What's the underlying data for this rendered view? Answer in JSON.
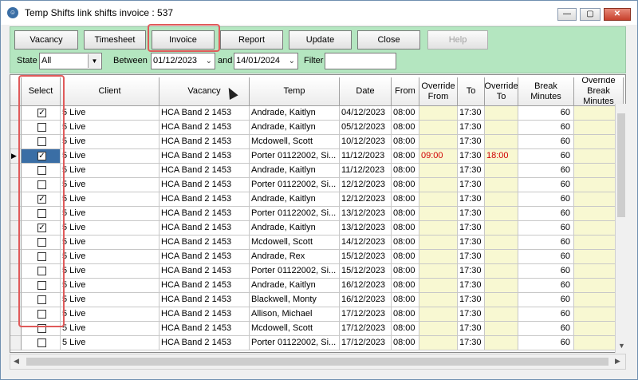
{
  "window": {
    "title": "Temp Shifts link shifts invoice : 537"
  },
  "toolbar": {
    "buttons": [
      {
        "label": "Vacancy"
      },
      {
        "label": "Timesheet"
      },
      {
        "label": "Invoice"
      },
      {
        "label": "Report"
      },
      {
        "label": "Update"
      },
      {
        "label": "Close"
      },
      {
        "label": "Help",
        "disabled": true
      }
    ],
    "state_label": "State",
    "state_value": "All",
    "between_label": "Between",
    "date_from": "01/12/2023",
    "and_label": "and",
    "date_to": "14/01/2024",
    "filter_label": "Filter",
    "filter_value": ""
  },
  "grid": {
    "headers": [
      "Select",
      "Client",
      "Vacancy",
      "Temp",
      "Date",
      "From",
      "Override From",
      "To",
      "Override To",
      "Break Minutes",
      "Override Break Minutes"
    ],
    "rows": [
      {
        "checked": true,
        "client": "5 Live",
        "vacancy": "HCA Band 2 1453",
        "temp": "Andrade, Kaitlyn",
        "date": "04/12/2023",
        "from": "08:00",
        "ofrom": "",
        "to": "17:30",
        "oto": "",
        "brk": "60"
      },
      {
        "checked": false,
        "client": "5 Live",
        "vacancy": "HCA Band 2 1453",
        "temp": "Andrade, Kaitlyn",
        "date": "05/12/2023",
        "from": "08:00",
        "ofrom": "",
        "to": "17:30",
        "oto": "",
        "brk": "60"
      },
      {
        "checked": false,
        "client": "5 Live",
        "vacancy": "HCA Band 2 1453",
        "temp": "Mcdowell, Scott",
        "date": "10/12/2023",
        "from": "08:00",
        "ofrom": "",
        "to": "17:30",
        "oto": "",
        "brk": "60"
      },
      {
        "checked": true,
        "current": true,
        "client": "5 Live",
        "vacancy": "HCA Band 2 1453",
        "temp": "Porter 01122002, Si...",
        "date": "11/12/2023",
        "from": "08:00",
        "ofrom": "09:00",
        "to": "17:30",
        "oto": "18:00",
        "brk": "60"
      },
      {
        "checked": false,
        "client": "5 Live",
        "vacancy": "HCA Band 2 1453",
        "temp": "Andrade, Kaitlyn",
        "date": "11/12/2023",
        "from": "08:00",
        "ofrom": "",
        "to": "17:30",
        "oto": "",
        "brk": "60"
      },
      {
        "checked": false,
        "client": "5 Live",
        "vacancy": "HCA Band 2 1453",
        "temp": "Porter 01122002, Si...",
        "date": "12/12/2023",
        "from": "08:00",
        "ofrom": "",
        "to": "17:30",
        "oto": "",
        "brk": "60"
      },
      {
        "checked": true,
        "client": "5 Live",
        "vacancy": "HCA Band 2 1453",
        "temp": "Andrade, Kaitlyn",
        "date": "12/12/2023",
        "from": "08:00",
        "ofrom": "",
        "to": "17:30",
        "oto": "",
        "brk": "60"
      },
      {
        "checked": false,
        "client": "5 Live",
        "vacancy": "HCA Band 2 1453",
        "temp": "Porter 01122002, Si...",
        "date": "13/12/2023",
        "from": "08:00",
        "ofrom": "",
        "to": "17:30",
        "oto": "",
        "brk": "60"
      },
      {
        "checked": true,
        "client": "5 Live",
        "vacancy": "HCA Band 2 1453",
        "temp": "Andrade, Kaitlyn",
        "date": "13/12/2023",
        "from": "08:00",
        "ofrom": "",
        "to": "17:30",
        "oto": "",
        "brk": "60"
      },
      {
        "checked": false,
        "client": "5 Live",
        "vacancy": "HCA Band 2 1453",
        "temp": "Mcdowell, Scott",
        "date": "14/12/2023",
        "from": "08:00",
        "ofrom": "",
        "to": "17:30",
        "oto": "",
        "brk": "60"
      },
      {
        "checked": false,
        "client": "5 Live",
        "vacancy": "HCA Band 2 1453",
        "temp": "Andrade, Rex",
        "date": "15/12/2023",
        "from": "08:00",
        "ofrom": "",
        "to": "17:30",
        "oto": "",
        "brk": "60"
      },
      {
        "checked": false,
        "client": "5 Live",
        "vacancy": "HCA Band 2 1453",
        "temp": "Porter 01122002, Si...",
        "date": "15/12/2023",
        "from": "08:00",
        "ofrom": "",
        "to": "17:30",
        "oto": "",
        "brk": "60"
      },
      {
        "checked": false,
        "client": "5 Live",
        "vacancy": "HCA Band 2 1453",
        "temp": "Andrade, Kaitlyn",
        "date": "16/12/2023",
        "from": "08:00",
        "ofrom": "",
        "to": "17:30",
        "oto": "",
        "brk": "60"
      },
      {
        "checked": false,
        "client": "5 Live",
        "vacancy": "HCA Band 2 1453",
        "temp": "Blackwell, Monty",
        "date": "16/12/2023",
        "from": "08:00",
        "ofrom": "",
        "to": "17:30",
        "oto": "",
        "brk": "60"
      },
      {
        "checked": false,
        "client": "5 Live",
        "vacancy": "HCA Band 2 1453",
        "temp": "Allison, Michael",
        "date": "17/12/2023",
        "from": "08:00",
        "ofrom": "",
        "to": "17:30",
        "oto": "",
        "brk": "60"
      },
      {
        "checked": false,
        "client": "5 Live",
        "vacancy": "HCA Band 2 1453",
        "temp": "Mcdowell, Scott",
        "date": "17/12/2023",
        "from": "08:00",
        "ofrom": "",
        "to": "17:30",
        "oto": "",
        "brk": "60"
      },
      {
        "checked": false,
        "client": "5 Live",
        "vacancy": "HCA Band 2 1453",
        "temp": "Porter 01122002, Si...",
        "date": "17/12/2023",
        "from": "08:00",
        "ofrom": "",
        "to": "17:30",
        "oto": "",
        "brk": "60"
      }
    ]
  },
  "colors": {
    "toolbar_bg": "#b4e6c0",
    "row_highlight": "#f8f8d2",
    "override_text": "#d00000",
    "annotation": "#e05a5a"
  }
}
